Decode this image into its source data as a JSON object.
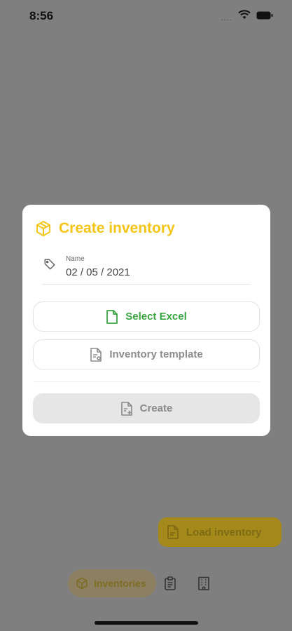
{
  "status_bar": {
    "time": "8:56",
    "signal_text": "....",
    "wifi_icon": "wifi-icon",
    "battery_icon": "battery-icon"
  },
  "dialog": {
    "header_icon": "box-icon",
    "title": "Create inventory",
    "name_field": {
      "icon": "tag-icon",
      "label": "Name",
      "value": "02 / 05 / 2021"
    },
    "select_excel": {
      "icon": "file-icon",
      "label": "Select Excel",
      "color": "#3aa640"
    },
    "inventory_template": {
      "icon": "file-template-icon",
      "label": "Inventory template"
    },
    "create": {
      "icon": "file-plus-icon",
      "label": "Create",
      "disabled": true
    }
  },
  "fab": {
    "icon": "file-icon",
    "label": "Load inventory"
  },
  "bottom_nav": {
    "items": [
      {
        "icon": "box-icon",
        "label": "Inventories",
        "active": true
      },
      {
        "icon": "clipboard-icon",
        "label": "",
        "active": false
      },
      {
        "icon": "building-icon",
        "label": "",
        "active": false
      }
    ]
  },
  "colors": {
    "accent": "#f5c518",
    "success": "#3aa640",
    "overlay": "#7f7f7f"
  }
}
